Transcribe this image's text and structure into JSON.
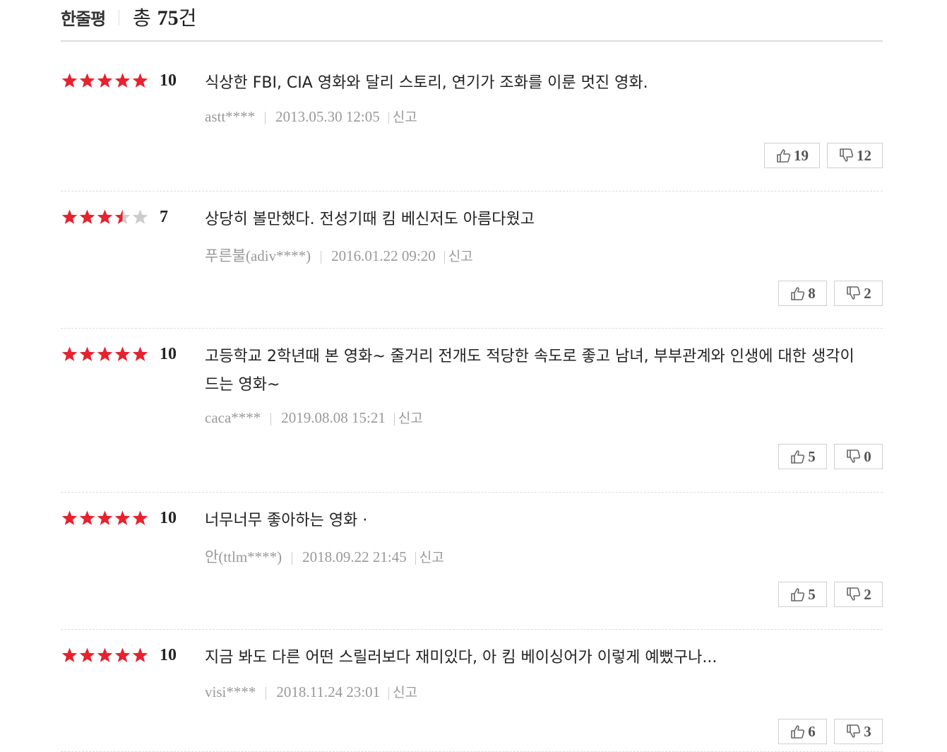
{
  "header": {
    "title": "한줄평",
    "total_prefix": "총 ",
    "total_count": "75",
    "total_suffix": "건"
  },
  "colors": {
    "star_on": "#e8212e",
    "star_off": "#cccccc"
  },
  "reviews": [
    {
      "stars": [
        1,
        1,
        1,
        1,
        1
      ],
      "score": "10",
      "text": "식상한 FBI, CIA 영화와 달리 스토리, 연기가 조화를 이룬 멋진 영화.",
      "author": "astt****",
      "date": "2013.05.30 12:05",
      "report": "신고",
      "likes": "19",
      "dislikes": "12"
    },
    {
      "stars": [
        1,
        1,
        1,
        0.5,
        0
      ],
      "score": "7",
      "text": "상당히 볼만했다. 전성기때 킴 베신저도 아름다웠고",
      "author": "푸른불(adiv****)",
      "date": "2016.01.22 09:20",
      "report": "신고",
      "likes": "8",
      "dislikes": "2"
    },
    {
      "stars": [
        1,
        1,
        1,
        1,
        1
      ],
      "score": "10",
      "text": "고등학교 2학년때 본 영화~ 줄거리 전개도 적당한 속도로 좋고 남녀, 부부관계와 인생에 대한 생각이 드는 영화~",
      "author": "caca****",
      "date": "2019.08.08 15:21",
      "report": "신고",
      "likes": "5",
      "dislikes": "0"
    },
    {
      "stars": [
        1,
        1,
        1,
        1,
        1
      ],
      "score": "10",
      "text": "너무너무 좋아하는 영화 ·",
      "author": "안(ttlm****)",
      "date": "2018.09.22 21:45",
      "report": "신고",
      "likes": "5",
      "dislikes": "2"
    },
    {
      "stars": [
        1,
        1,
        1,
        1,
        1
      ],
      "score": "10",
      "text": "지금 봐도 다른 어떤 스릴러보다 재미있다, 아 킴 베이싱어가 이렇게 예뻤구나...",
      "author": "visi****",
      "date": "2018.11.24 23:01",
      "report": "신고",
      "likes": "6",
      "dislikes": "3"
    }
  ]
}
